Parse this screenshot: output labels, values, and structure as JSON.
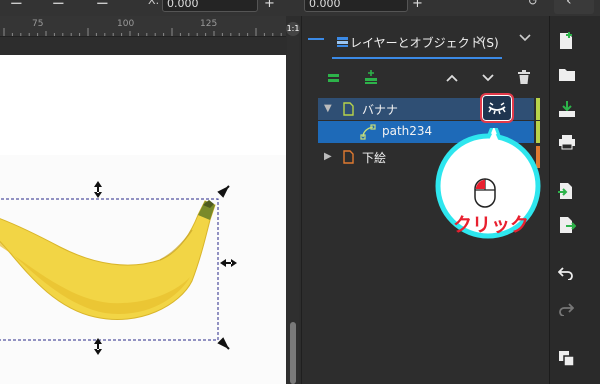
{
  "toolbar": {
    "x_label": "X:",
    "x_value": "0.000",
    "y_value": "0.000",
    "plus": "+"
  },
  "ruler": {
    "labels": [
      "75",
      "100",
      "125"
    ]
  },
  "zoom_badge": "1:1",
  "panel": {
    "tab_label": "レイヤーとオブジェクト(S)",
    "tab_close": "✕",
    "layers": [
      {
        "name": "バナナ",
        "expanded": true,
        "color": "#b8d44a"
      },
      {
        "name": "path234",
        "child": true,
        "color": "#b8d44a"
      },
      {
        "name": "下絵",
        "expanded": false,
        "color": "#e07a30"
      }
    ]
  },
  "callout": {
    "text": "クリック",
    "ring_color": "#2ee6ee",
    "text_color": "#e8202f"
  },
  "icons": {
    "add_layer": "add-layer-icon",
    "raise": "chevron-up-icon",
    "lower": "chevron-down-icon",
    "delete": "trash-icon",
    "eye": "eye-closed-icon",
    "lock": "lock-icon"
  }
}
